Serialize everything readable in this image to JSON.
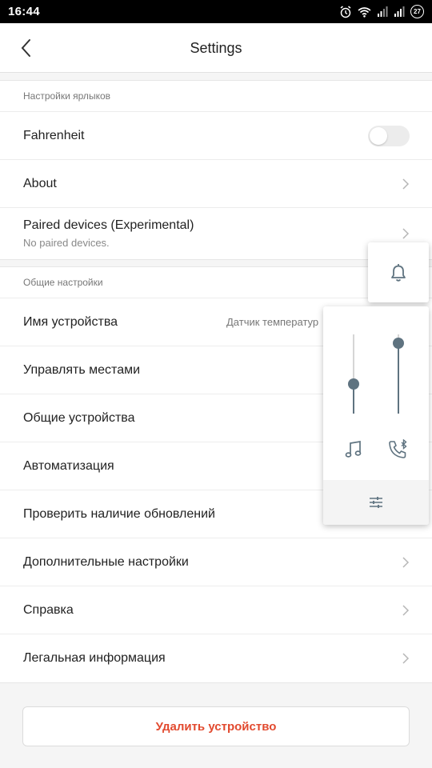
{
  "status_bar": {
    "time": "16:44",
    "battery_level": "27",
    "icons": [
      "alarm-icon",
      "wifi-icon",
      "signal-icon",
      "signal-icon",
      "battery-icon"
    ]
  },
  "header": {
    "title": "Settings",
    "back_icon": "chevron-left-icon"
  },
  "section_shortcuts": {
    "title": "Настройки ярлыков",
    "fahrenheit": {
      "label": "Fahrenheit",
      "enabled": false
    },
    "about": {
      "label": "About"
    },
    "paired": {
      "label": "Paired devices (Experimental)",
      "sub": "No paired devices."
    }
  },
  "section_general": {
    "title": "Общие настройки",
    "items": [
      {
        "label": "Имя устройства",
        "value": "Датчик температур"
      },
      {
        "label": "Управлять местами"
      },
      {
        "label": "Общие устройства"
      },
      {
        "label": "Автоматизация"
      },
      {
        "label": "Проверить наличие обновлений"
      },
      {
        "label": "Дополнительные настройки"
      },
      {
        "label": "Справка"
      },
      {
        "label": "Легальная информация"
      }
    ]
  },
  "delete_button": {
    "label": "Удалить устройство"
  },
  "volume_panel": {
    "ringer_icon": "bell-icon",
    "sliders": [
      {
        "name": "media-volume",
        "icon": "music-note-icon",
        "level": 0.35
      },
      {
        "name": "bluetooth-call-volume",
        "icon": "bluetooth-phone-icon",
        "level": 0.95
      }
    ],
    "settings_icon": "sliders-icon"
  },
  "colors": {
    "accent_delete": "#e24a2f",
    "slider": "#5f7380",
    "toggle_off": "#ececec"
  }
}
